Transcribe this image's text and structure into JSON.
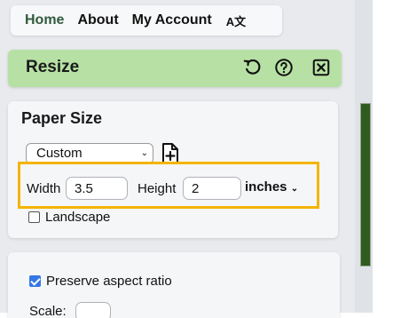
{
  "nav": {
    "items": [
      {
        "label": "Home",
        "active": true
      },
      {
        "label": "About",
        "active": false
      },
      {
        "label": "My Account",
        "active": false
      }
    ],
    "language_icon": "A文"
  },
  "panel": {
    "title": "Resize",
    "icons": [
      "undo-icon",
      "help-icon",
      "close-icon"
    ]
  },
  "paper_size": {
    "title": "Paper Size",
    "preset": "Custom",
    "add_icon": "add-document-icon",
    "width_label": "Width",
    "width_value": "3.5",
    "height_label": "Height",
    "height_value": "2",
    "units": "inches",
    "landscape_label": "Landscape",
    "landscape_checked": false
  },
  "scaling": {
    "preserve_label": "Preserve aspect ratio",
    "preserve_checked": true,
    "scale_label": "Scale:",
    "scale_value": ""
  },
  "colors": {
    "header_bg": "#b7e1a4",
    "highlight": "#f4b400",
    "checkbox": "#3578e5",
    "nav_active": "#2f5b3b"
  }
}
